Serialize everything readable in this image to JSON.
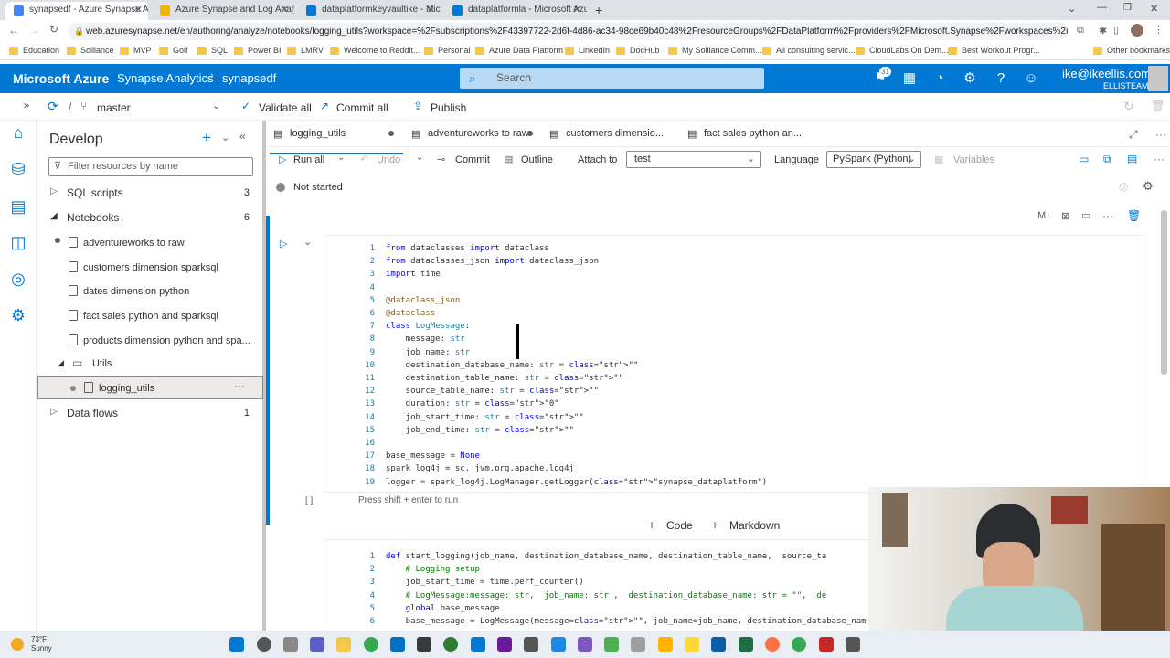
{
  "browser": {
    "tabs": [
      {
        "label": "synapsedf - Azure Synapse Analy",
        "color": "#4285f4"
      },
      {
        "label": "Azure Synapse and Log Analytics",
        "color": "#f4b400"
      },
      {
        "label": "dataplatformkeyvaultike - Micro",
        "color": "#0078d4"
      },
      {
        "label": "dataplatformla - Microsoft Azure",
        "color": "#0078d4"
      }
    ],
    "url": "web.azuresynapse.net/en/authoring/analyze/notebooks/logging_utils?workspace=%2Fsubscriptions%2F43397722-2d6f-4d86-ac34-98ce69b40c48%2FresourceGroups%2FDataPlatform%2Fproviders%2FMicrosoft.Synapse%2Fworkspaces%2Fsy...",
    "bookmarks": [
      "Education",
      "Solliance",
      "MVP",
      "Golf",
      "SQL",
      "Power BI",
      "LMRV",
      "Welcome to Reddit...",
      "Personal",
      "Azure Data Platform",
      "LinkedIn",
      "DocHub",
      "My Solliance Comm...",
      "All consulting servic...",
      "CloudLabs On Dem...",
      "Best Workout Progr..."
    ],
    "other_bookmarks": "Other bookmarks"
  },
  "header": {
    "brand": "Microsoft Azure",
    "service": "Synapse Analytics",
    "workspace": "synapsedf",
    "search_placeholder": "Search",
    "notif_count": "31",
    "user": "ike@ikeellis.com",
    "tenant": "ELLISTEAM"
  },
  "toolbar": {
    "branch": "master",
    "validate": "Validate all",
    "commit": "Commit all",
    "publish": "Publish"
  },
  "develop": {
    "title": "Develop",
    "filter_placeholder": "Filter resources by name",
    "sql_scripts": {
      "label": "SQL scripts",
      "count": "3"
    },
    "notebooks": {
      "label": "Notebooks",
      "count": "6"
    },
    "items": [
      "adventureworks to raw",
      "customers dimension sparksql",
      "dates dimension python",
      "fact sales python and sparksql",
      "products dimension python and spa..."
    ],
    "folder": "Utils",
    "folder_item": "logging_utils",
    "dataflows": {
      "label": "Data flows",
      "count": "1"
    }
  },
  "notebook_tabs": [
    "logging_utils",
    "adventureworks to raw",
    "customers dimensio...",
    "fact sales python an..."
  ],
  "nb_toolbar": {
    "run_all": "Run all",
    "undo": "Undo",
    "commit": "Commit",
    "outline": "Outline",
    "attach_label": "Attach to",
    "attach_value": "test",
    "lang_label": "Language",
    "lang_value": "PySpark (Python)",
    "variables": "Variables"
  },
  "status": "Not started",
  "cell1": {
    "exec": "[ ]",
    "hint": "Press shift + enter to run",
    "lines": [
      "from dataclasses import dataclass",
      "from dataclasses_json import dataclass_json",
      "import time",
      "",
      "@dataclass_json",
      "@dataclass",
      "class LogMessage:",
      "    message: str",
      "    job_name: str",
      "    destination_database_name: str = \"\"",
      "    destination_table_name: str = \"\"",
      "    source_table_name: str = \"\"",
      "    duration: str = \"0\"",
      "    job_start_time: str = \"\"",
      "    job_end_time: str = \"\"",
      "",
      "base_message = None",
      "spark_log4j = sc._jvm.org.apache.log4j",
      "logger = spark_log4j.LogManager.getLogger(\"synapse_dataplatform\")"
    ]
  },
  "add_cell": {
    "code": "Code",
    "markdown": "Markdown"
  },
  "cell2": {
    "lines": [
      "def start_logging(job_name, destination_database_name, destination_table_name,  source_ta",
      "    # Logging setup",
      "    job_start_time = time.perf_counter()",
      "    # LogMessage:message: str,  job_name: str ,  destination_database_name: str = \"\",  de",
      "    global base_message",
      "    base_message = LogMessage(message=\"\", job_name=job_name, destination_database_name=de"
    ]
  },
  "weather": {
    "temp": "73°F",
    "desc": "Sunny"
  }
}
